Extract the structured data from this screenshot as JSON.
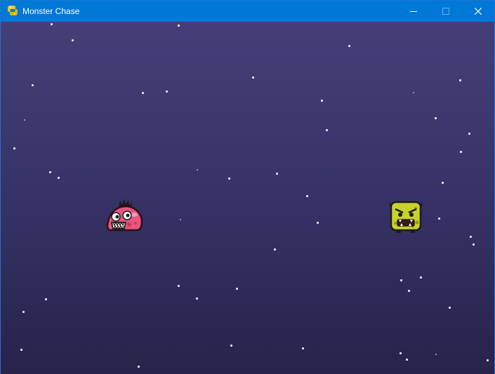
{
  "window": {
    "title": "Monster Chase",
    "app_icon": "python-snake-icon",
    "controls": [
      "minimize-icon",
      "maximize-icon",
      "close-icon"
    ]
  },
  "game": {
    "player": {
      "type": "pink-blob-monster",
      "color": "#e8557e"
    },
    "enemy": {
      "type": "yellow-block-monster",
      "color": "#c9d22a"
    },
    "background_colors": [
      "#443f76",
      "#27234a"
    ]
  }
}
